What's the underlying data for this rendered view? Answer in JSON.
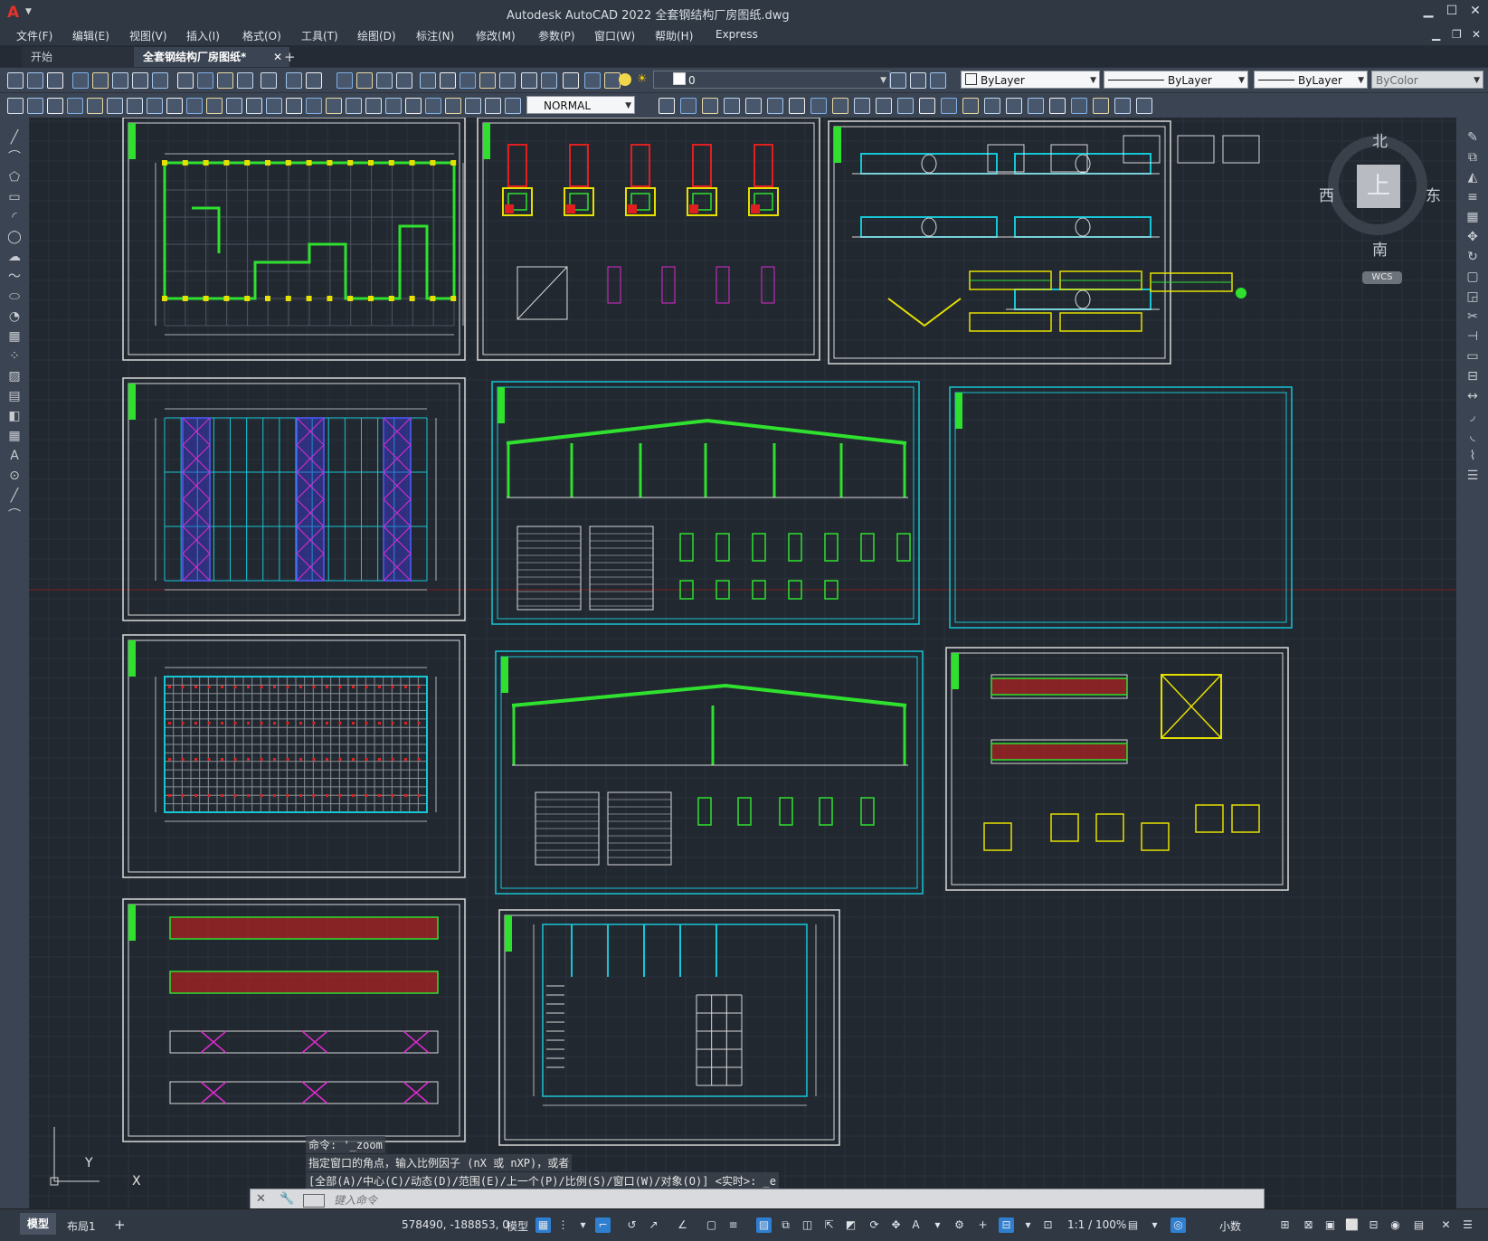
{
  "window": {
    "title": "Autodesk AutoCAD 2022    全套钢结构厂房图纸.dwg",
    "logo": "A",
    "controls": [
      "▁",
      "☐",
      "✕"
    ]
  },
  "menu": {
    "items": [
      "文件(F)",
      "编辑(E)",
      "视图(V)",
      "插入(I)",
      "格式(O)",
      "工具(T)",
      "绘图(D)",
      "标注(N)",
      "修改(M)",
      "参数(P)",
      "窗口(W)",
      "帮助(H)",
      "Express"
    ],
    "doc_controls": [
      "▁",
      "❐",
      "✕"
    ]
  },
  "tabs": {
    "start": "开始",
    "active": "全套钢结构厂房图纸*",
    "close": "✕",
    "add": "+"
  },
  "toolbars": {
    "layer_value": "0",
    "color_value": "ByLayer",
    "linetype_value": "ByLayer",
    "lineweight_value": "ByLayer",
    "plotstyle_value": "ByColor",
    "text_style_value": "NORMAL"
  },
  "viewcube": {
    "north": "北",
    "south": "南",
    "east": "东",
    "west": "西",
    "face": "上",
    "wcs": "WCS"
  },
  "ucs": {
    "x_label": "X",
    "y_label": "Y"
  },
  "command": {
    "line1": "命令: '_zoom",
    "line2": "指定窗口的角点，输入比例因子 (nX 或 nXP)，或者",
    "line3": "[全部(A)/中心(C)/动态(D)/范围(E)/上一个(P)/比例(S)/窗口(W)/对象(O)] <实时>: _e",
    "placeholder": "键入命令"
  },
  "status": {
    "model_tab": "模型",
    "layout_tab": "布局1",
    "add_tab": "+",
    "coords": "578490, -188853, 0",
    "model_label": "模型",
    "scale": "1:1 / 100%",
    "units": "小数"
  },
  "colors": {
    "background": "#212830",
    "grid_major": "#2c343e",
    "cyan": "#16c6d6",
    "green": "#2fe02f",
    "white": "#d9d9d9",
    "red": "#e02020",
    "yellow": "#e6e000",
    "magenta": "#e02ad0"
  }
}
